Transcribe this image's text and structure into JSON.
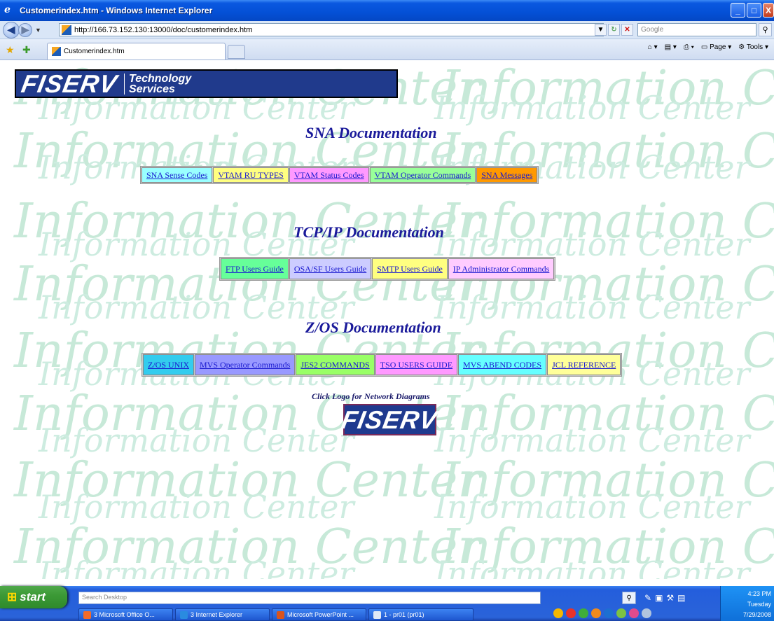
{
  "window": {
    "title": "Customerindex.htm - Windows Internet Explorer",
    "minimize": "_",
    "maximize": "□",
    "close": "X"
  },
  "address": {
    "url": "http://166.73.152.130:13000/doc/customerindex.htm",
    "search_placeholder": "Google"
  },
  "tabbar": {
    "tab_title": "Customerindex.htm",
    "page_label": "Page",
    "tools_label": "Tools"
  },
  "banner": {
    "logo_text": "FISERV",
    "tagline_line1": "Technology",
    "tagline_line2": "Services"
  },
  "watermark_text": "Information Center",
  "sections": [
    {
      "title": "SNA Documentation",
      "links": [
        {
          "label": "SNA Sense Codes",
          "color": "#99ffff"
        },
        {
          "label": "VTAM RU TYPES",
          "color": "#ffff80"
        },
        {
          "label": "VTAM Status Codes",
          "color": "#ff99ff"
        },
        {
          "label": "VTAM Operator Commands",
          "color": "#99ff99"
        },
        {
          "label": "SNA Messages",
          "color": "#ff9900"
        }
      ]
    },
    {
      "title": "TCP/IP Documentation",
      "links": [
        {
          "label": "FTP Users Guide",
          "color": "#66ff99"
        },
        {
          "label": "OSA/SF Users Guide",
          "color": "#ccccff"
        },
        {
          "label": "SMTP Users Guide",
          "color": "#ffff80"
        },
        {
          "label": "IP Administrator Commands",
          "color": "#ffccff"
        }
      ]
    },
    {
      "title": "Z/OS Documentation",
      "links": [
        {
          "label": "Z/OS UNIX",
          "color": "#33ccee"
        },
        {
          "label": "MVS Operator Commands",
          "color": "#9999ff"
        },
        {
          "label": "JES2 COMMANDS",
          "color": "#99ff66"
        },
        {
          "label": "TSO USERS GUIDE",
          "color": "#ff99ff"
        },
        {
          "label": "MVS ABEND CODES",
          "color": "#66ffff"
        },
        {
          "label": "JCL REFERENCE",
          "color": "#ffff99"
        }
      ]
    }
  ],
  "network": {
    "caption": "Click Logo for Network Diagrams",
    "logo_text": "FISERV"
  },
  "taskbar": {
    "start_label": "start",
    "search_placeholder": "Search Desktop",
    "tasks": [
      {
        "label": "3 Microsoft Office O...",
        "color": "#f26b2a"
      },
      {
        "label": "3 Internet Explorer",
        "color": "#2a8be0"
      },
      {
        "label": "Microsoft PowerPoint ...",
        "color": "#d9541e"
      },
      {
        "label": "1 - pr01 (pr01)",
        "color": "#dfe8f6"
      }
    ],
    "time": "4:23 PM",
    "day": "Tuesday",
    "date": "7/29/2008"
  }
}
